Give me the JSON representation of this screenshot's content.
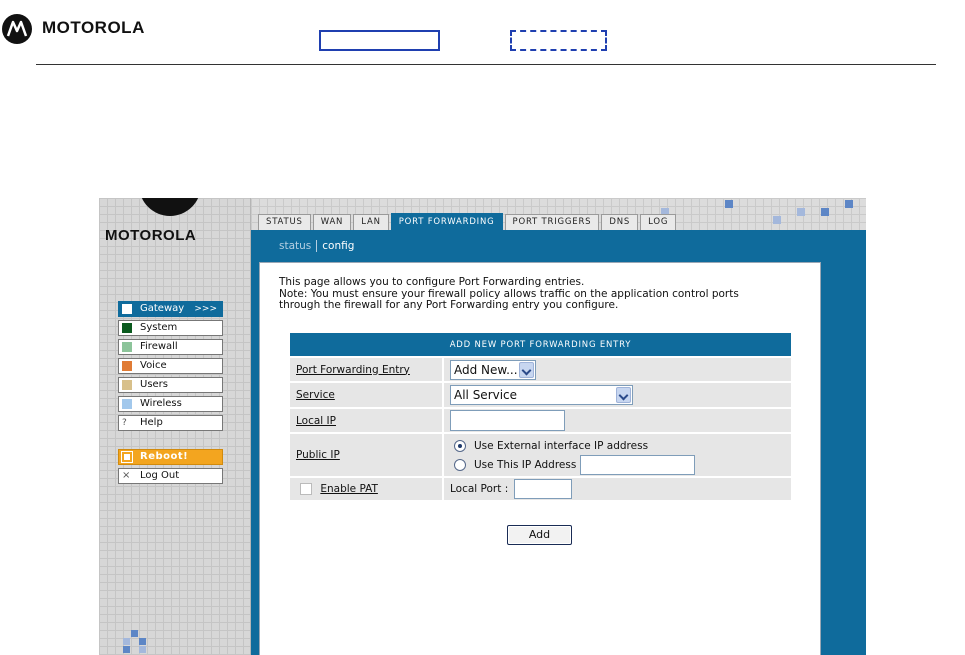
{
  "doc_header": {
    "brand": "MOTOROLA"
  },
  "app": {
    "brand": "MOTOROLA",
    "tabs": [
      {
        "label": "STATUS",
        "active": false
      },
      {
        "label": "WAN",
        "active": false
      },
      {
        "label": "LAN",
        "active": false
      },
      {
        "label": "PORT FORWARDING",
        "active": true
      },
      {
        "label": "PORT TRIGGERS",
        "active": false
      },
      {
        "label": "DNS",
        "active": false
      },
      {
        "label": "LOG",
        "active": false
      }
    ],
    "subnav": {
      "status": "status",
      "config": "config"
    },
    "menu": {
      "gateway": {
        "label": "Gateway",
        "arrows": ">>>",
        "color": "#ffffff"
      },
      "system": {
        "label": "System",
        "color": "#0a5a1e"
      },
      "firewall": {
        "label": "Firewall",
        "color": "#8cc49a"
      },
      "voice": {
        "label": "Voice",
        "color": "#e07b35"
      },
      "users": {
        "label": "Users",
        "color": "#d8c08a"
      },
      "wireless": {
        "label": "Wireless",
        "color": "#a2c8ec"
      },
      "help": {
        "label": "Help",
        "glyph": "?"
      },
      "reboot": {
        "label": "Reboot!"
      },
      "logout": {
        "label": "Log Out",
        "glyph": "×"
      }
    },
    "intro_text": {
      "line1": "This page allows you to configure Port Forwarding entries.",
      "line2": "Note: You must ensure your firewall policy allows traffic on the application control ports",
      "line3": "through the firewall for any Port Forwarding entry you configure."
    },
    "form": {
      "header": "ADD NEW PORT FORWARDING ENTRY",
      "entry": {
        "label": "Port Forwarding Entry",
        "selected": "Add New..."
      },
      "service": {
        "label": "Service",
        "selected": "All Service"
      },
      "local_ip": {
        "label": "Local IP",
        "value": ""
      },
      "public_ip": {
        "label": "Public IP",
        "option_external": "Use External interface IP address",
        "option_this": "Use This IP Address",
        "selected": "external",
        "this_ip_value": ""
      },
      "enable_pat": {
        "label": "Enable PAT",
        "checked": false
      },
      "local_port": {
        "label": "Local Port :",
        "value": ""
      },
      "add_button": "Add"
    },
    "colors": {
      "accent": "#0f6b9c",
      "reboot": "#f3a51f"
    }
  }
}
